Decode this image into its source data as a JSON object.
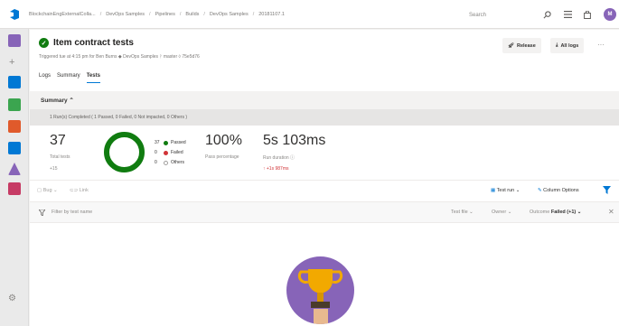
{
  "topbar": {
    "breadcrumbs": [
      "BlockchainEngExternalColla...",
      "DevOps Samples",
      "Pipelines",
      "Builds",
      "DevOps Samples",
      "20181107.1"
    ],
    "search_label": "Search",
    "avatar_initials": "M"
  },
  "header": {
    "title": "Item contract tests",
    "subtitle": "Triggered tue at 4:15 pm for Ben Burns  ◆ DevOps Samples  ᚹ master  ◊ 75e5d76",
    "release_label": "Release",
    "all_logs_label": "All logs",
    "more_label": "···",
    "tabs": [
      {
        "label": "Logs"
      },
      {
        "label": "Summary"
      },
      {
        "label": "Tests"
      }
    ]
  },
  "summary": {
    "heading": "Summary ⌃",
    "runs_text": "1 Run(s) Completed ( 1 Passed, 0 Failed, 0 Not impacted, 0 Others )",
    "total_tests": "37",
    "total_tests_label": "Total tests",
    "total_delta": "+15",
    "legend": [
      {
        "count": "37",
        "label": "Passed",
        "color": "#107c10"
      },
      {
        "count": "0",
        "label": "Failed",
        "color": "#d13438"
      },
      {
        "count": "0",
        "label": "Others",
        "color": "#a19f9d"
      }
    ],
    "pass_percentage": "100%",
    "pass_percentage_label": "Pass percentage",
    "run_duration": "5s 103ms",
    "run_duration_label": "Run duration ⓘ",
    "run_duration_delta": "↑ +1s 987ms"
  },
  "toolbar": {
    "bug_label": "Bug ⌄",
    "link_label": "Link",
    "test_run_label": "Test run ⌄",
    "column_options_label": "Column Options"
  },
  "filters": {
    "filter_placeholder": "Filter by test name",
    "test_file_label": "Test file ⌄",
    "owner_label": "Owner ⌄",
    "outcome_label": "Outcome",
    "outcome_value": "Failed (+1) ⌄"
  },
  "colors": {
    "accent": "#0078d4",
    "success": "#107c10",
    "failure": "#d13438",
    "trophy_bg": "#8764b8"
  }
}
